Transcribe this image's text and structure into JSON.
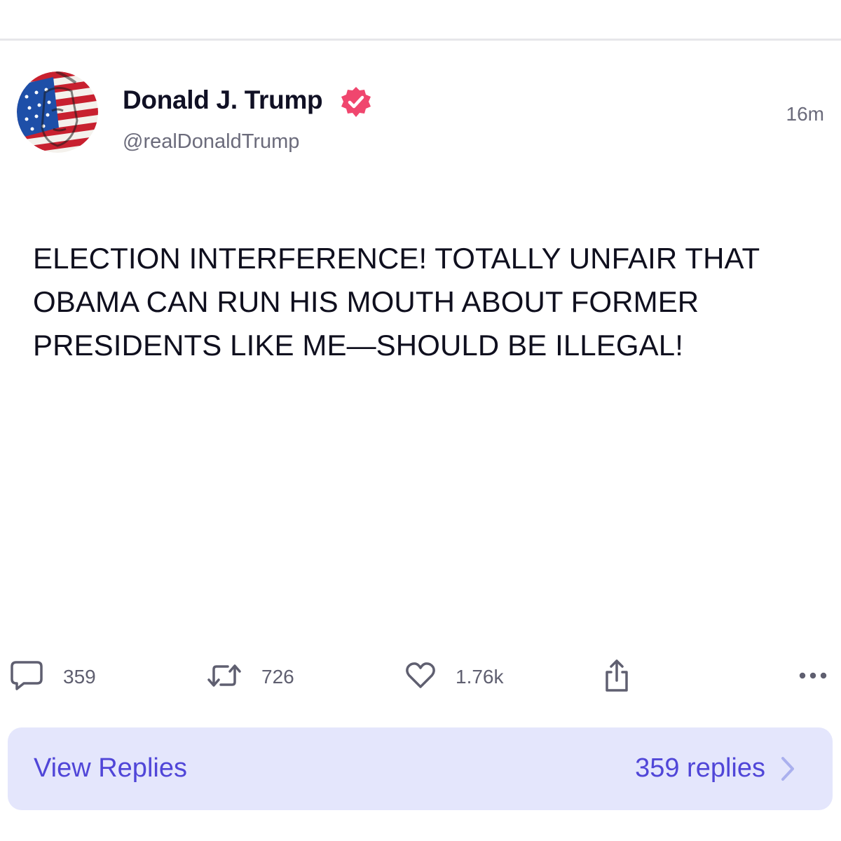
{
  "post": {
    "author": {
      "display_name": "Donald J. Trump",
      "handle": "@realDonaldTrump",
      "verified": true
    },
    "timestamp": "16m",
    "text": "ELECTION INTERFERENCE! TOTALLY UNFAIR THAT OBAMA CAN RUN HIS MOUTH ABOUT FORMER PRESIDENTS LIKE ME—SHOULD BE ILLEGAL!",
    "actions": {
      "replies": "359",
      "reposts": "726",
      "likes": "1.76k"
    },
    "icons": {
      "reply": "comment-bubble-icon",
      "repost": "repost-arrows-icon",
      "like": "heart-icon",
      "share": "share-upload-icon",
      "more": "more-dots-icon",
      "verified": "verified-badge-icon",
      "chevron": "chevron-right-icon"
    }
  },
  "replies_bar": {
    "label": "View Replies",
    "count_label": "359 replies"
  },
  "colors": {
    "accent": "#5046d8",
    "replies_bar_bg": "#e4e6fc",
    "verified_badge": "#f0466e",
    "muted_text": "#6b6b7b",
    "icon_gray": "#5f5f70"
  }
}
